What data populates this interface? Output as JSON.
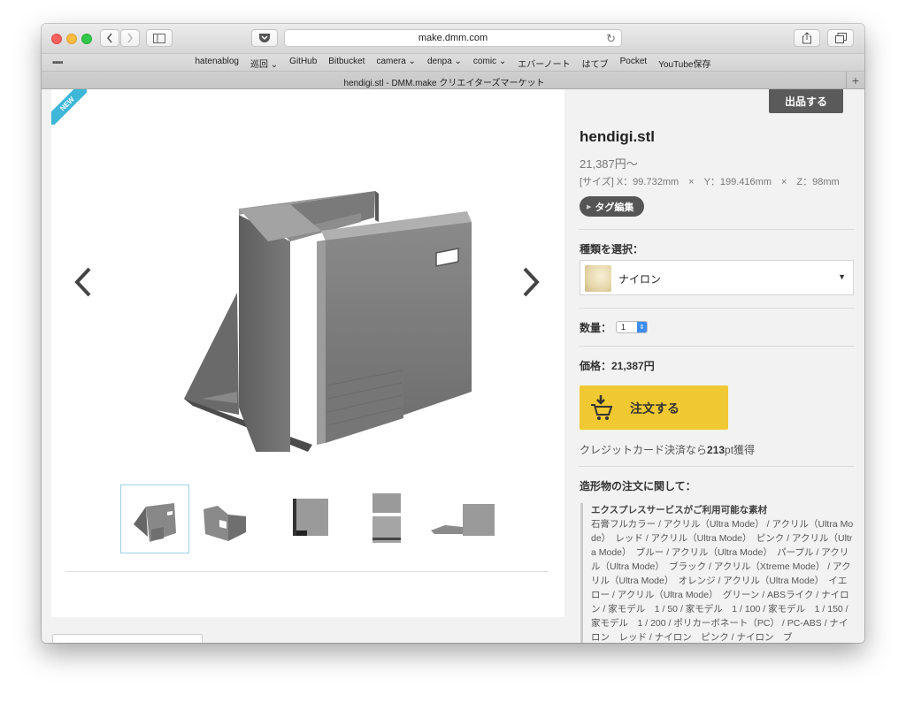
{
  "browser": {
    "url": "make.dmm.com",
    "bookmarks": [
      "hatenablog",
      "巡回 ⌄",
      "GitHub",
      "Bitbucket",
      "camera ⌄",
      "denpa ⌄",
      "comic ⌄",
      "エバーノート",
      "はてブ",
      "Pocket",
      "YouTube保存"
    ],
    "tab_title": "hendigi.stl - DMM.make クリエイターズマーケット"
  },
  "viewer": {
    "badge": "NEW",
    "thumbnail_count": 5,
    "selected_thumbnail": 1
  },
  "product": {
    "sell_button": "出品する",
    "title": "hendigi.stl",
    "price_from": "21,387円〜",
    "size": "[サイズ] X：99.732mm　×　Y：199.416mm　×　Z：98mm",
    "tag_edit": "タグ編集",
    "material_label": "種類を選択：",
    "material_value": "ナイロン",
    "quantity_label": "数量：",
    "quantity_value": "1",
    "price_label": "価格：21,387円",
    "order_button": "注文する",
    "credit_prefix": "クレジットカード決済なら",
    "credit_points": "213",
    "credit_suffix": "pt獲得",
    "order_about": "造形物の注文に関して：",
    "service_title": "エクスプレスサービスがご利用可能な素材",
    "service_list": "石膏フルカラー / アクリル（Ultra Mode） / アクリル（Ultra Mode）　レッド / アクリル（Ultra Mode）　ピンク / アクリル（Ultra Mode）　ブルー / アクリル（Ultra Mode）　パープル / アクリル（Ultra Mode）　ブラック / アクリル（Xtreme Mode） / アクリル（Ultra Mode）　オレンジ / アクリル（Ultra Mode）　イエロー / アクリル（Ultra Mode）　グリーン / ABSライク / ナイロン / 家モデル　1 / 50 / 家モデル　1 / 100 / 家モデル　1 / 150 / 家モデル　1 / 200 / ポリカーボネート（PC） / PC-ABS / ナイロン　レッド / ナイロン　ピンク / ナイロン　ブ"
  },
  "colors": {
    "accent_order": "#f0c832",
    "ribbon": "#3fb7d8",
    "sell_button": "#5a5a5a"
  }
}
